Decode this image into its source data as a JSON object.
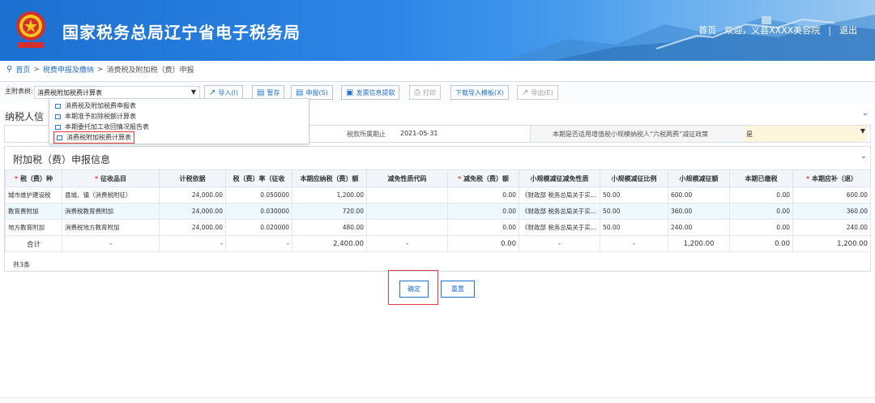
{
  "header": {
    "title": "国家税务总局辽宁省电子税务局",
    "home": "首页",
    "welcome": "欢迎，义县XXXX美容院",
    "sep": "|",
    "logout": "退出"
  },
  "breadcrumb": {
    "home": "首页",
    "sep1": ">",
    "level2": "税费申报及缴纳",
    "sep2": ">",
    "current": "消费税及附加税（费）申报"
  },
  "toolbar": {
    "label": "主附表树:",
    "selected": "消费税附加税费计算表",
    "import": "导入(I)",
    "save": "暂存",
    "declare": "申报(S)",
    "invoice": "发票信息提取",
    "print": "打印",
    "download": "下载导入模板(X)",
    "export": "导出(E)"
  },
  "dropdown": {
    "items": [
      "消费税及附加税费申报表",
      "本期准予扣除税额计算表",
      "本期委托加工收回情况报告表",
      "消费税附加税费计算表"
    ]
  },
  "taxpayer": {
    "title": "纳税人信",
    "period_label": "税款所属期止",
    "period_value": "2021-05-31",
    "policy_label": "本期是否适用增值税小规模纳税人“六税两费”减征政策",
    "policy_value": "是"
  },
  "panel": {
    "title": "附加税（费）申报信息",
    "columns": [
      "税（费）种",
      "征收品目",
      "计税依据",
      "税（费）率（征收",
      "本期应纳税（费）额",
      "减免性质代码",
      "减免税（费）额",
      "小规模减征减免性质",
      "小规模减征比例",
      "小规模减征额",
      "本期已缴税",
      "本期应补（退）"
    ],
    "required_mark": "*",
    "rows": [
      [
        "城市维护建设税",
        "县城、镇（消费税附征）",
        "24,000.00",
        "0.050000",
        "1,200.00",
        "",
        "0.00",
        "《财政部 税务总局关于实施...",
        "50.00",
        "600.00",
        "0.00",
        "600.00"
      ],
      [
        "教育费附加",
        "消费税教育费附加",
        "24,000.00",
        "0.030000",
        "720.00",
        "",
        "0.00",
        "《财政部 税务总局关于实施...",
        "50.00",
        "360.00",
        "0.00",
        "360.00"
      ],
      [
        "地方教育附加",
        "消费税地方教育附加",
        "24,000.00",
        "0.020000",
        "480.00",
        "",
        "0.00",
        "《财政部 税务总局关于实施...",
        "50.00",
        "240.00",
        "0.00",
        "240.00"
      ]
    ],
    "total": [
      "合计",
      "-",
      "-",
      "-",
      "2,400.00",
      "-",
      "0.00",
      "-",
      "-",
      "1,200.00",
      "0.00",
      "1,200.00"
    ],
    "count": "共3条"
  },
  "buttons": {
    "confirm": "确定",
    "reset": "重置"
  },
  "colors": {
    "accent": "#1e6fd1",
    "highlight": "#e33b3b"
  }
}
